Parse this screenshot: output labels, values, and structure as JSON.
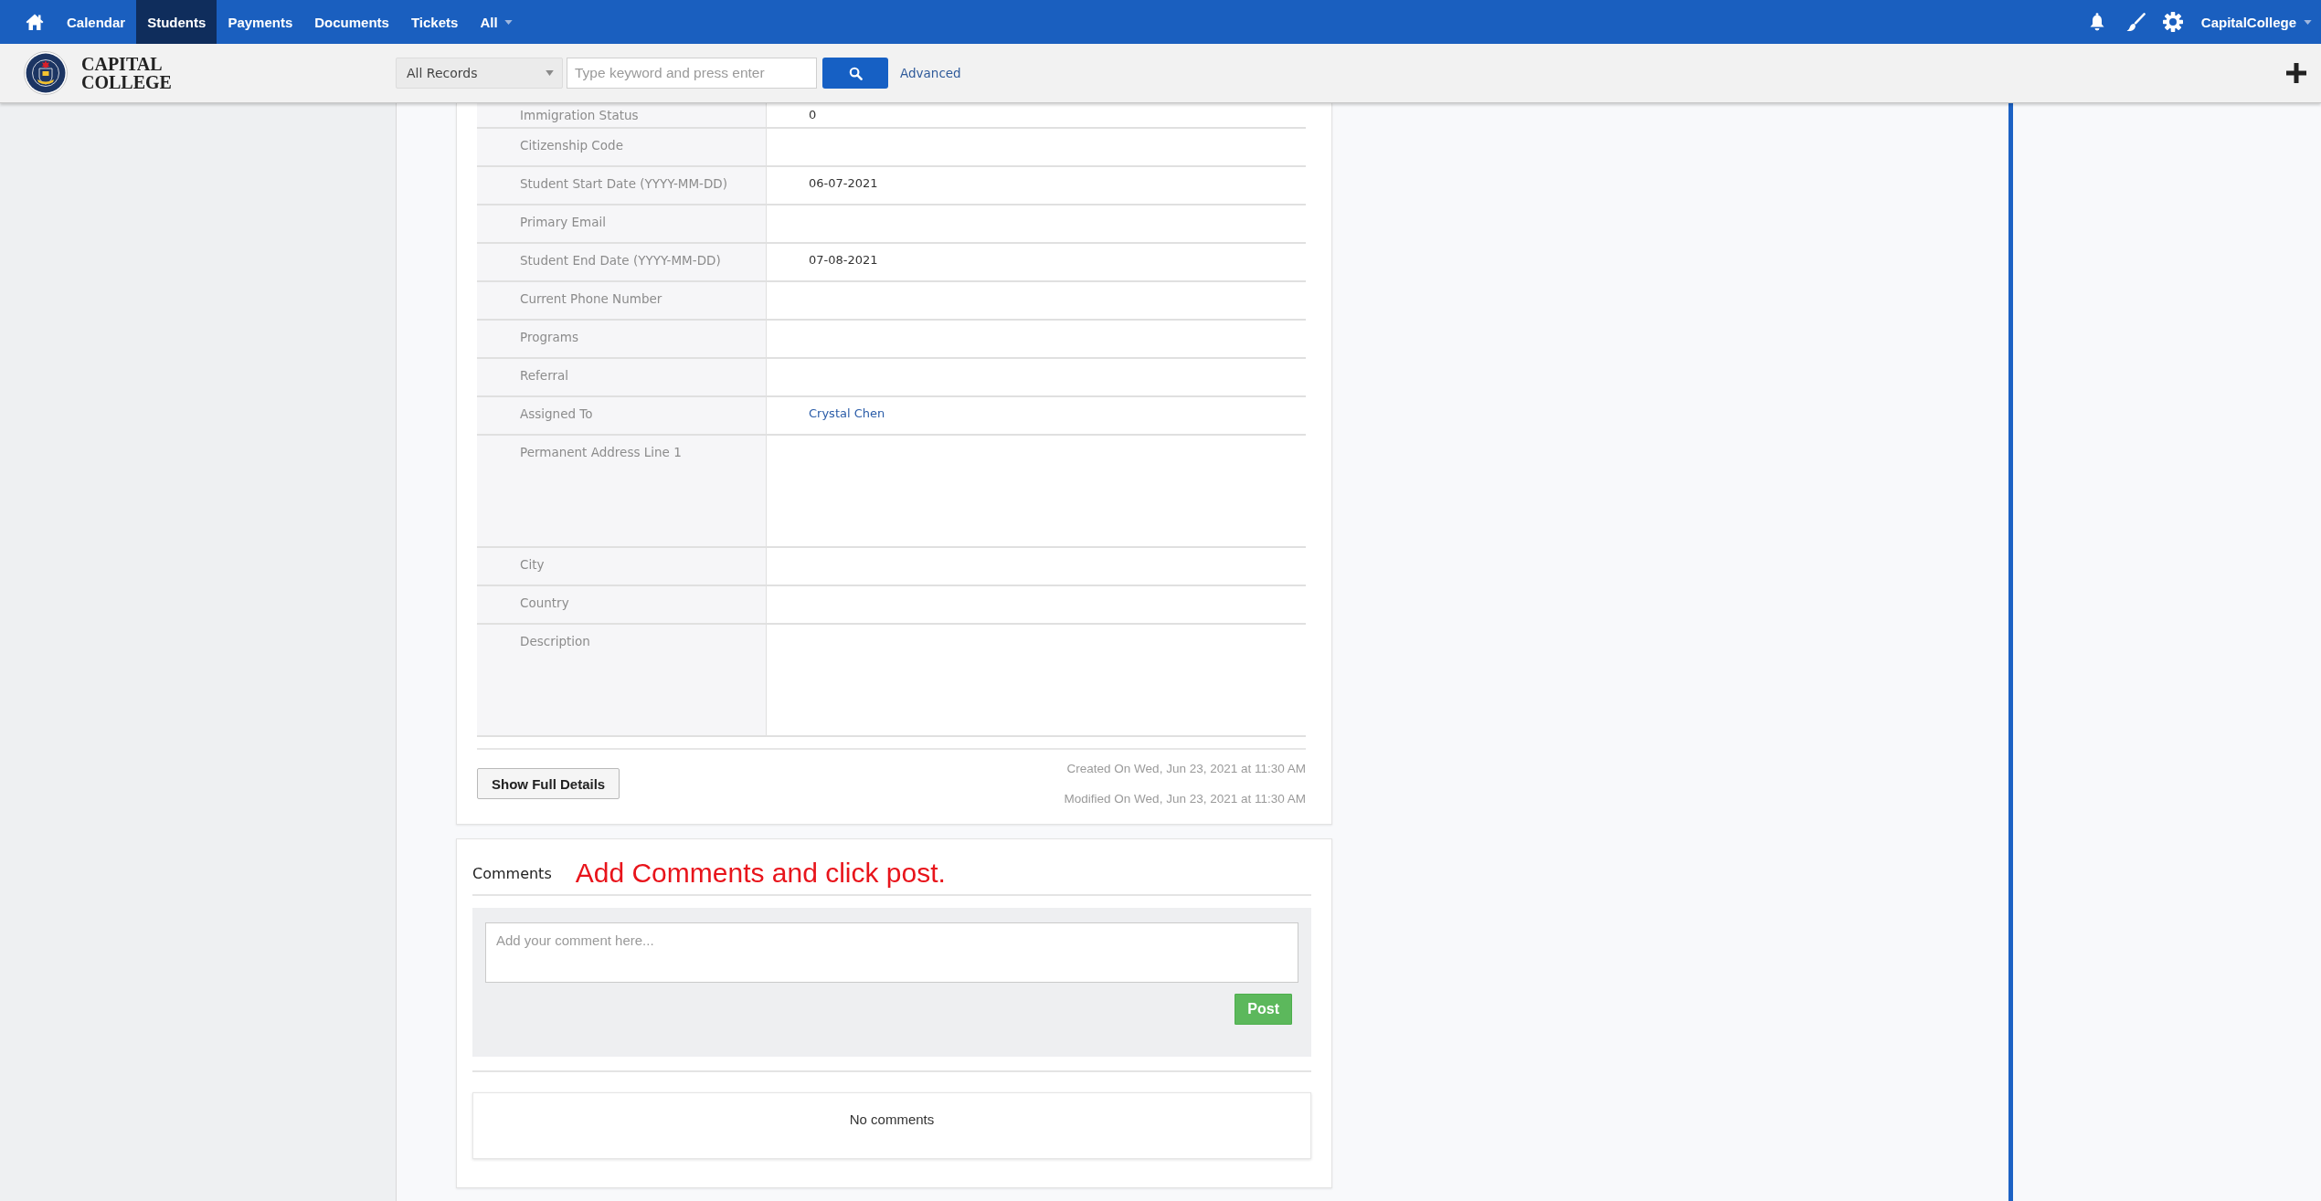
{
  "nav": {
    "items": [
      {
        "label": "Calendar",
        "selected": false,
        "dropdown": false
      },
      {
        "label": "Students",
        "selected": true,
        "dropdown": false
      },
      {
        "label": "Payments",
        "selected": false,
        "dropdown": false
      },
      {
        "label": "Documents",
        "selected": false,
        "dropdown": false
      },
      {
        "label": "Tickets",
        "selected": false,
        "dropdown": false
      },
      {
        "label": "All",
        "selected": false,
        "dropdown": true
      }
    ],
    "account": "CapitalCollege"
  },
  "brand": {
    "lines": [
      "CAPITAL",
      "COLLEGE"
    ]
  },
  "search": {
    "scope": "All Records",
    "placeholder": "Type keyword and press enter",
    "advanced_link": "Advanced"
  },
  "details": {
    "rows": [
      {
        "label": "Immigration Status",
        "value": "0",
        "kind": "text"
      },
      {
        "label": "Citizenship Code",
        "kind": "text"
      },
      {
        "label": "Student Start Date (YYYY-MM-DD)",
        "value": "06-07-2021",
        "kind": "text"
      },
      {
        "label": "Primary Email",
        "kind": "text"
      },
      {
        "label": "Student End Date (YYYY-MM-DD)",
        "value": "07-08-2021",
        "kind": "text"
      },
      {
        "label": "Current Phone Number",
        "kind": "text"
      },
      {
        "label": "Programs",
        "kind": "text"
      },
      {
        "label": "Referral",
        "kind": "text"
      },
      {
        "label": "Assigned To",
        "value": "Crystal Chen",
        "kind": "link"
      },
      {
        "label": "Permanent Address Line 1",
        "kind": "textarea"
      },
      {
        "label": "City",
        "kind": "text"
      },
      {
        "label": "Country",
        "kind": "text"
      },
      {
        "label": "Description",
        "kind": "textarea"
      }
    ],
    "show_full_details_button": "Show Full Details",
    "created": "Created On Wed, Jun 23, 2021 at 11:30 AM",
    "modified": "Modified On Wed, Jun 23, 2021 at 11:30 AM"
  },
  "comments": {
    "title": "Comments",
    "annotation": "Add Comments and click post.",
    "placeholder": "Add your comment here...",
    "post_button": "Post",
    "empty_text": "No comments"
  }
}
